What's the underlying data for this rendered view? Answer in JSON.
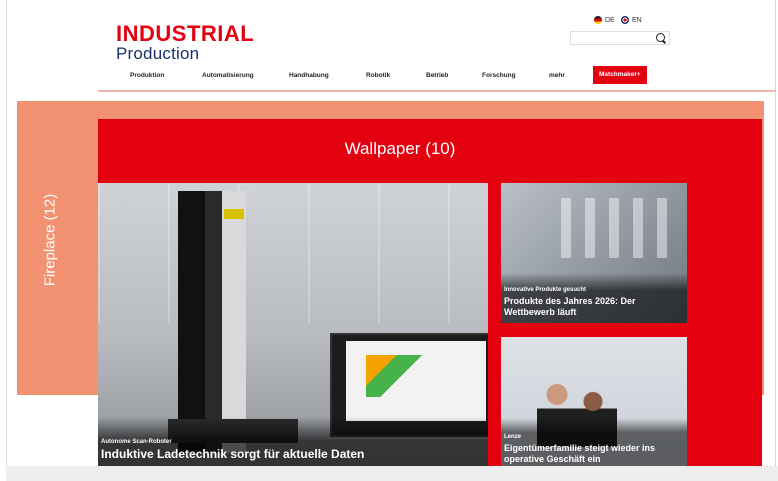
{
  "header": {
    "logo_line1": "INDUSTRIAL",
    "logo_line2": "Production",
    "languages": [
      "DE",
      "EN"
    ],
    "search_icon": "search-icon",
    "search_placeholder": ""
  },
  "nav": {
    "items": [
      "Produktion",
      "Automatisierung",
      "Handhabung",
      "Robotik",
      "Betrieb",
      "Forschung",
      "mehr"
    ],
    "cta": "Matchmaker+"
  },
  "ads": {
    "fireplace": "Fireplace (12)",
    "wallpaper": "Wallpaper (10)"
  },
  "teasers": {
    "main": {
      "kicker": "Autonome Scan-Roboter",
      "headline": "Induktive Ladetechnik sorgt für aktuelle Daten"
    },
    "right_top": {
      "kicker": "Innovative Produkte gesucht",
      "headline": "Produkte des Jahres 2026: Der Wettbewerb läuft"
    },
    "right_bottom": {
      "kicker": "Lenze",
      "headline": "Eigentümerfamilie steigt wieder ins operative Geschäft ein"
    }
  },
  "colors": {
    "brand_red": "#e3000f",
    "brand_blue": "#1b2f6e",
    "fireplace": "#f29272"
  }
}
